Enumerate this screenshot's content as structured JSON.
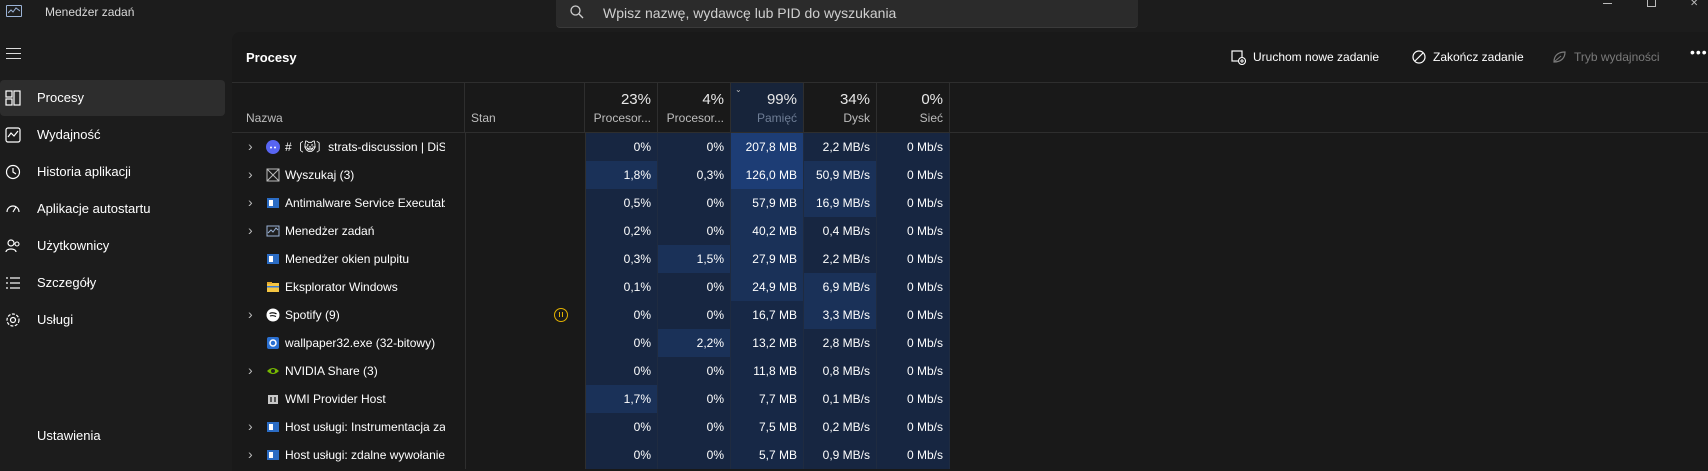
{
  "app": {
    "title": "Menedżer zadań",
    "search_placeholder": "Wpisz nazwę, wydawcę lub PID do wyszukania"
  },
  "sidebar": {
    "items": [
      {
        "label": "Procesy",
        "icon": "processes-icon",
        "active": true
      },
      {
        "label": "Wydajność",
        "icon": "performance-icon"
      },
      {
        "label": "Historia aplikacji",
        "icon": "history-icon"
      },
      {
        "label": "Aplikacje autostartu",
        "icon": "startup-icon"
      },
      {
        "label": "Użytkownicy",
        "icon": "users-icon"
      },
      {
        "label": "Szczegóły",
        "icon": "details-icon"
      },
      {
        "label": "Usługi",
        "icon": "services-icon"
      }
    ],
    "settings_label": "Ustawienia"
  },
  "main": {
    "title": "Procesy",
    "toolbar": {
      "new_task": "Uruchom nowe zadanie",
      "end_task": "Zakończ zadanie",
      "efficiency": "Tryb wydajności"
    }
  },
  "table": {
    "columns": {
      "name": "Nazwa",
      "status": "Stan",
      "cpu": {
        "pct": "23%",
        "label": "Procesor..."
      },
      "gpu": {
        "pct": "4%",
        "label": "Procesor..."
      },
      "memory": {
        "pct": "99%",
        "label": "Pamięć"
      },
      "disk": {
        "pct": "34%",
        "label": "Dysk"
      },
      "network": {
        "pct": "0%",
        "label": "Sieć"
      }
    },
    "rows": [
      {
        "name": "#〔😺〕strats-discussion | DiS | T...",
        "expand": true,
        "icon": "discord-icon",
        "cpu": "0%",
        "gpu": "0%",
        "mem": "207,8 MB",
        "disk": "2,2 MB/s",
        "net": "0 Mb/s"
      },
      {
        "name": "Wyszukaj (3)",
        "expand": true,
        "icon": "search-app-icon",
        "cpu": "1,8%",
        "gpu": "0,3%",
        "mem": "126,0 MB",
        "disk": "50,9 MB/s",
        "net": "0 Mb/s"
      },
      {
        "name": "Antimalware Service Executable",
        "expand": true,
        "icon": "antimalware-icon",
        "cpu": "0,5%",
        "gpu": "0%",
        "mem": "57,9 MB",
        "disk": "16,9 MB/s",
        "net": "0 Mb/s"
      },
      {
        "name": "Menedżer zadań",
        "expand": true,
        "icon": "task-manager-icon",
        "cpu": "0,2%",
        "gpu": "0%",
        "mem": "40,2 MB",
        "disk": "0,4 MB/s",
        "net": "0 Mb/s"
      },
      {
        "name": "Menedżer okien pulpitu",
        "expand": false,
        "icon": "dwm-icon",
        "cpu": "0,3%",
        "gpu": "1,5%",
        "mem": "27,9 MB",
        "disk": "2,2 MB/s",
        "net": "0 Mb/s"
      },
      {
        "name": "Eksplorator Windows",
        "expand": false,
        "icon": "folder-icon",
        "cpu": "0,1%",
        "gpu": "0%",
        "mem": "24,9 MB",
        "disk": "6,9 MB/s",
        "net": "0 Mb/s"
      },
      {
        "name": "Spotify (9)",
        "expand": true,
        "icon": "spotify-icon",
        "status": "paused",
        "cpu": "0%",
        "gpu": "0%",
        "mem": "16,7 MB",
        "disk": "3,3 MB/s",
        "net": "0 Mb/s"
      },
      {
        "name": "wallpaper32.exe (32-bitowy)",
        "expand": false,
        "icon": "wallpaper-icon",
        "cpu": "0%",
        "gpu": "2,2%",
        "mem": "13,2 MB",
        "disk": "2,8 MB/s",
        "net": "0 Mb/s"
      },
      {
        "name": "NVIDIA Share (3)",
        "expand": true,
        "icon": "nvidia-icon",
        "cpu": "0%",
        "gpu": "0%",
        "mem": "11,8 MB",
        "disk": "0,8 MB/s",
        "net": "0 Mb/s"
      },
      {
        "name": "WMI Provider Host",
        "expand": false,
        "icon": "wmi-icon",
        "cpu": "1,7%",
        "gpu": "0%",
        "mem": "7,7 MB",
        "disk": "0,1 MB/s",
        "net": "0 Mb/s"
      },
      {
        "name": "Host usługi: Instrumentacja za...",
        "expand": true,
        "icon": "service-host-icon",
        "cpu": "0%",
        "gpu": "0%",
        "mem": "7,5 MB",
        "disk": "0,2 MB/s",
        "net": "0 Mb/s"
      },
      {
        "name": "Host usługi: zdalne wywołanie...",
        "expand": true,
        "icon": "service-host-icon",
        "cpu": "0%",
        "gpu": "0%",
        "mem": "5,7 MB",
        "disk": "0,9 MB/s",
        "net": "0 Mb/s"
      }
    ]
  }
}
